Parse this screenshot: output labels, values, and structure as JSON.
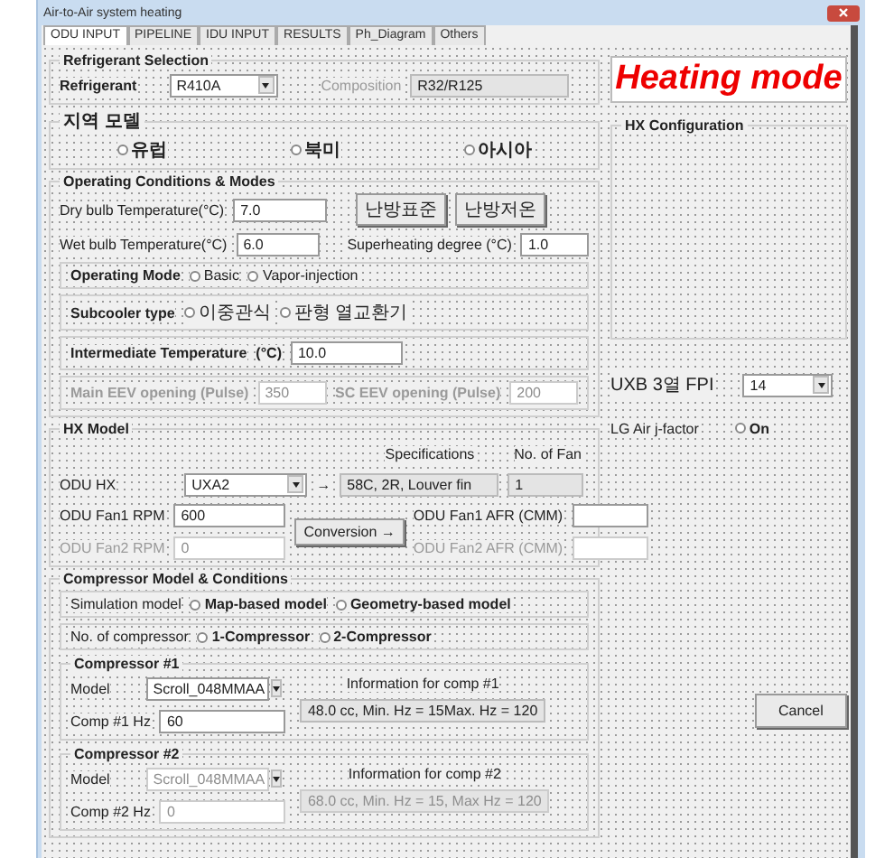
{
  "window": {
    "title": "Air-to-Air system heating"
  },
  "tabs": [
    {
      "label": "ODU INPUT",
      "selected": true
    },
    {
      "label": "PIPELINE",
      "selected": false
    },
    {
      "label": "IDU INPUT",
      "selected": false
    },
    {
      "label": "RESULTS",
      "selected": false
    },
    {
      "label": "Ph_Diagram",
      "selected": false
    },
    {
      "label": "Others",
      "selected": false
    }
  ],
  "refrigerant_selection": {
    "title": "Refrigerant Selection",
    "refrigerant_label": "Refrigerant",
    "refrigerant_value": "R410A",
    "composition_label": "Composition",
    "composition_value": "R32/R125"
  },
  "region_model": {
    "title": "지역 모델",
    "options": [
      {
        "label": "유럽",
        "selected": false
      },
      {
        "label": "북미",
        "selected": false
      },
      {
        "label": "아시아",
        "selected": false
      }
    ]
  },
  "operating": {
    "title": "Operating Conditions & Modes",
    "dry_bulb_label": "Dry bulb Temperature(°C)",
    "dry_bulb_value": "7.0",
    "wet_bulb_label": "Wet bulb Temperature(°C)",
    "wet_bulb_value": "6.0",
    "buttons": [
      "난방표준",
      "난방저온"
    ],
    "superheating_label": "Superheating degree (°C)",
    "superheating_value": "1.0",
    "operating_mode": {
      "label": "Operating Mode",
      "options": [
        {
          "label": "Basic",
          "selected": false
        },
        {
          "label": "Vapor-injection",
          "selected": false
        }
      ]
    },
    "subcooler": {
      "label": "Subcooler type",
      "options": [
        {
          "label": "이중관식",
          "selected": false
        },
        {
          "label": "판형 열교환기",
          "selected": false
        }
      ]
    },
    "intermediate": {
      "label": "Intermediate Temperature",
      "unit": "(°C)",
      "value": "10.0"
    },
    "main_eev": {
      "label": "Main EEV opening (Pulse)",
      "value": "350",
      "disabled": true
    },
    "sc_eev": {
      "label": "SC EEV opening (Pulse)",
      "value": "200",
      "disabled": true
    }
  },
  "hx_model": {
    "title": "HX Model",
    "odu_hx_label": "ODU HX",
    "odu_hx_value": "UXA2",
    "arrow": "→",
    "specifications_header": "Specifications",
    "specifications_value": "58C, 2R, Louver fin",
    "fans_header": "No. of Fan",
    "fans_value": "1",
    "fan1_rpm_label": "ODU Fan1 RPM",
    "fan1_rpm_value": "600",
    "fan2_rpm_label": "ODU Fan2 RPM",
    "fan2_rpm_value": "0",
    "fan2_disabled": true,
    "conversion_button": "Conversion →",
    "fan1_afr_label": "ODU Fan1 AFR (CMM)",
    "fan2_afr_label": "ODU Fan2 AFR (CMM)"
  },
  "compressor": {
    "title": "Compressor Model & Conditions",
    "simulation": {
      "label": "Simulation model",
      "options": [
        {
          "label": "Map-based model",
          "selected": false
        },
        {
          "label": "Geometry-based model",
          "selected": false
        }
      ]
    },
    "count": {
      "label": "No. of compressor",
      "options": [
        {
          "label": "1-Compressor",
          "selected": false
        },
        {
          "label": "2-Compressor",
          "selected": false
        }
      ]
    },
    "units": [
      {
        "title": "Compressor #1",
        "model_label": "Model",
        "model_value": "Scroll_048MMAA",
        "hz_label": "Comp #1 Hz",
        "hz_value": "60",
        "info_label": "Information for comp #1",
        "info_value": "48.0 cc, Min. Hz = 15Max. Hz = 120",
        "disabled": false
      },
      {
        "title": "Compressor #2",
        "model_label": "Model",
        "model_value": "Scroll_048MMAA",
        "hz_label": "Comp #2 Hz",
        "hz_value": "0",
        "info_label": "Information for comp #2",
        "info_value": "68.0 cc, Min. Hz = 15, Max Hz = 120",
        "disabled": true
      }
    ]
  },
  "mode_banner": "Heating mode",
  "hx_configuration": {
    "title": "HX Configuration"
  },
  "fpi": {
    "label": "UXB 3열 FPI",
    "value": "14"
  },
  "jfactor": {
    "label": "LG Air j-factor",
    "option": {
      "label": "On",
      "selected": false
    }
  },
  "cancel_button": "Cancel"
}
